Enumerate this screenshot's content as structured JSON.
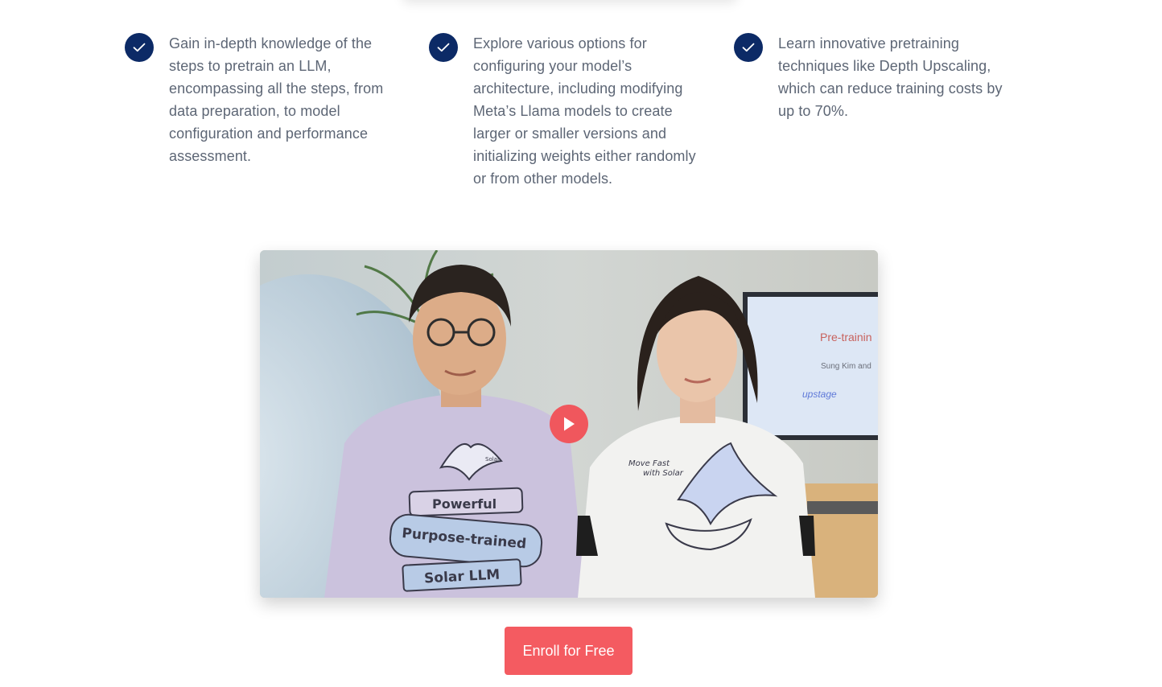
{
  "benefits": [
    {
      "text": "Gain in-depth knowledge of the steps to pretrain an LLM, encompassing all the steps, from data preparation, to model configuration and performance assessment.",
      "icon": "check-icon"
    },
    {
      "text": "Explore various options for configuring your model’s architecture, including modifying Meta’s Llama models to create larger or smaller versions and initializing weights either randomly or from other models.",
      "icon": "check-icon"
    },
    {
      "text": "Learn innovative pretraining techniques like Depth Upscaling, which can reduce training costs by up to 70%.",
      "icon": "check-icon"
    }
  ],
  "video": {
    "play_icon": "play-icon",
    "thumbnail": {
      "screen_title": "Pre-trainin",
      "screen_names": "Sung Kim and",
      "screen_logo": "upstage",
      "shirt_left": [
        "Powerful",
        "Purpose-trained",
        "Solar LLM"
      ],
      "shirt_left_tag": "Solar",
      "shirt_right": [
        "Move Fast",
        "with Solar"
      ]
    }
  },
  "cta": {
    "enroll_label": "Enroll for Free"
  },
  "colors": {
    "check_bg": "#0c2a66",
    "accent": "#f45b61",
    "body_text": "#5d6675"
  }
}
